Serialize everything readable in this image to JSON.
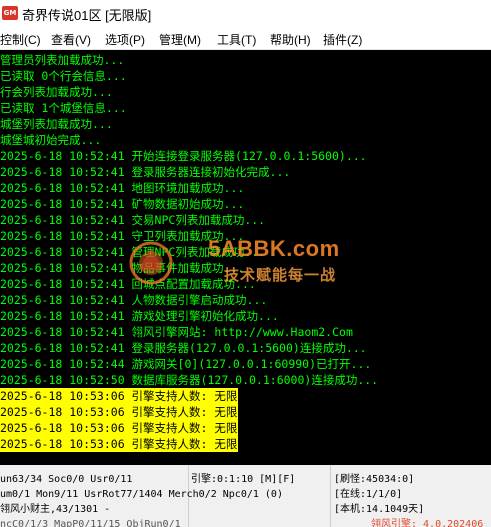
{
  "window": {
    "icon_label": "GM",
    "title": "奇界传说01区 [无限版]"
  },
  "menu": [
    "控制(C)",
    "查看(V)",
    "选项(P)",
    "管理(M)",
    "工具(T)",
    "帮助(H)",
    "插件(Z)"
  ],
  "console": {
    "colors": {
      "background": "#000000",
      "text": "#00ff00",
      "highlight_bg": "#ffff00",
      "highlight_text": "#000000"
    },
    "lines": [
      {
        "text": "管理员列表加载成功...",
        "highlight": false
      },
      {
        "text": "已读取 0个行会信息...",
        "highlight": false
      },
      {
        "text": "行会列表加载成功...",
        "highlight": false
      },
      {
        "text": "已读取 1个城堡信息...",
        "highlight": false
      },
      {
        "text": "城堡列表加载成功...",
        "highlight": false
      },
      {
        "text": "城堡城初始完成...",
        "highlight": false
      },
      {
        "text": "2025-6-18 10:52:41 开始连接登录服务器(127.0.0.1:5600)...",
        "highlight": false
      },
      {
        "text": "2025-6-18 10:52:41 登录服务器连接初始化完成...",
        "highlight": false
      },
      {
        "text": "2025-6-18 10:52:41 地图环境加载成功...",
        "highlight": false
      },
      {
        "text": "2025-6-18 10:52:41 矿物数据初始成功...",
        "highlight": false
      },
      {
        "text": "2025-6-18 10:52:41 交易NPC列表加载成功...",
        "highlight": false
      },
      {
        "text": "2025-6-18 10:52:41 守卫列表加载成功...",
        "highlight": false
      },
      {
        "text": "2025-6-18 10:52:41 管理NPC列表加载成功...",
        "highlight": false
      },
      {
        "text": "2025-6-18 10:52:41 物品事件加载成功...",
        "highlight": false
      },
      {
        "text": "2025-6-18 10:52:41 回城点配置加载成功...",
        "highlight": false
      },
      {
        "text": "2025-6-18 10:52:41 人物数据引擎启动成功...",
        "highlight": false
      },
      {
        "text": "2025-6-18 10:52:41 游戏处理引擎初始化成功...",
        "highlight": false
      },
      {
        "text": "2025-6-18 10:52:41 翎风引擎网站: http://www.Haom2.Com",
        "highlight": false
      },
      {
        "text": "2025-6-18 10:52:41 登录服务器(127.0.0.1:5600)连接成功...",
        "highlight": false
      },
      {
        "text": "2025-6-18 10:52:44 游戏网关[0](127.0.0.1:60990)已打开...",
        "highlight": false
      },
      {
        "text": "2025-6-18 10:52:50 数据库服务器(127.0.0.1:6000)连接成功...",
        "highlight": false
      },
      {
        "text": "2025-6-18 10:53:06 引擎支持人数: 无限",
        "highlight": true
      },
      {
        "text": "2025-6-18 10:53:06 引擎支持人数: 无限",
        "highlight": true
      },
      {
        "text": "2025-6-18 10:53:06 引擎支持人数: 无限",
        "highlight": true
      },
      {
        "text": "2025-6-18 10:53:06 引擎支持人数: 无限",
        "highlight": true
      }
    ]
  },
  "watermark": {
    "top": "5ABBK.com",
    "bottom": "技术赋能每一战"
  },
  "status": {
    "row1_col1": "un63/34 Soc0/0 Usr0/11",
    "row1_col2": "引擎:0:1:10 [M][F]",
    "row1_col3": "[刷怪:45034:0]",
    "row2_col1": "um0/1 Mon9/11 UsrRot77/1404 Merch0/2 Npc0/1 (0)",
    "row2_col3": "[在线:1/1/0]",
    "row3_col1": "翎风小财主,43/1301 -",
    "row3_col3": "[本机:14.1049天]",
    "row4_col1": "ncC0/1/3 MapP0/11/15 ObjRun0/1",
    "row4_col3": "翎风引擎: 4.0.202406"
  }
}
